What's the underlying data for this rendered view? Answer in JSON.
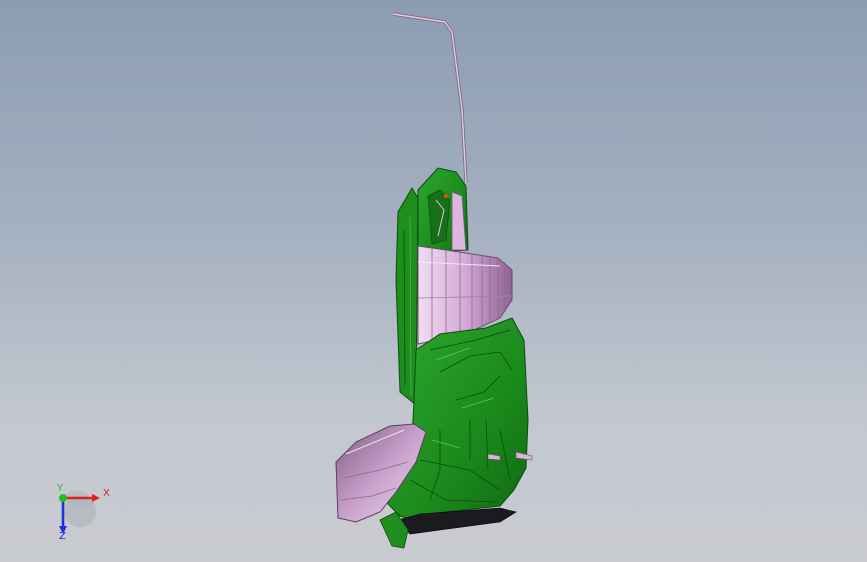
{
  "viewport": {
    "background_top": "#8b9cb3",
    "background_bottom": "#c9cbd0"
  },
  "model": {
    "body_color": "#1f8a1f",
    "body_dark": "#0d5a10",
    "shell_color": "#d9b3dc",
    "shell_dark": "#8a5f8c",
    "wire_color": "#c9a6cc",
    "base_color": "#1a1a1f"
  },
  "triad": {
    "x_label": "X",
    "y_label": "Y",
    "z_label": "Z",
    "x_color": "#e02020",
    "y_color": "#20c020",
    "z_color": "#2030e0"
  }
}
